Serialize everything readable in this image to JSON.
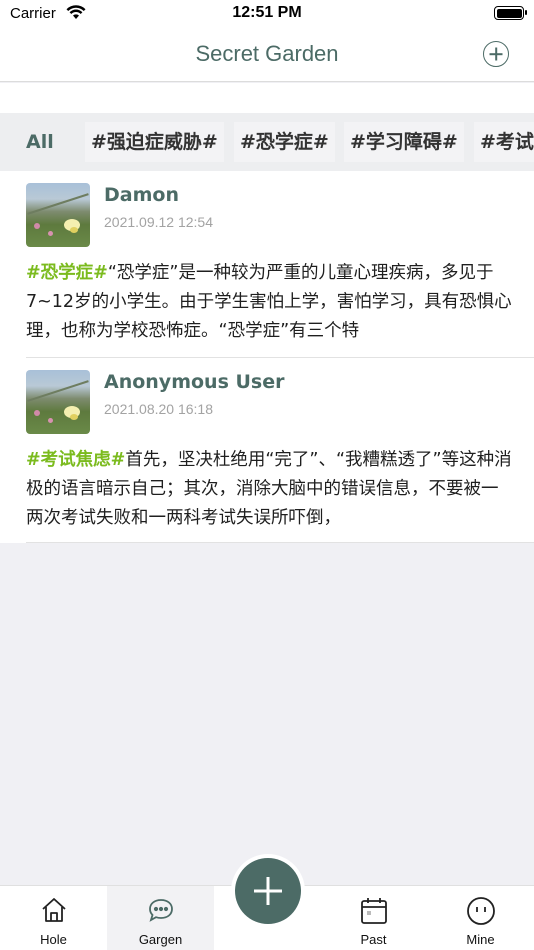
{
  "status_bar": {
    "carrier": "Carrier",
    "time": "12:51 PM"
  },
  "nav": {
    "title": "Secret Garden"
  },
  "tags": [
    "All",
    "#强迫症威胁#",
    "#恐学症#",
    "#学习障碍#",
    "#考试"
  ],
  "posts": [
    {
      "user": "Damon",
      "time": "2021.09.12 12:54",
      "hashtag": "#恐学症#",
      "text": "“恐学症”是一种较为严重的儿童心理疾病，多见于7~12岁的小学生。由于学生害怕上学，害怕学习，具有恐惧心理，也称为学校恐怖症。“恐学症”有三个特"
    },
    {
      "user": "Anonymous User",
      "time": "2021.08.20 16:18",
      "hashtag": "#考试焦虑#",
      "text": "首先，坚决杜绝用“完了”、“我糟糕透了”等这种消极的语言暗示自己；其次，消除大脑中的错误信息，不要被一两次考试失败和一两科考试失误所吓倒，"
    }
  ],
  "tab_bar": {
    "tabs": [
      {
        "label": "Hole",
        "icon": "home-icon"
      },
      {
        "label": "Gargen",
        "icon": "chat-bubble-icon"
      },
      {
        "label": "Past",
        "icon": "calendar-icon"
      },
      {
        "label": "Mine",
        "icon": "smiley-icon"
      }
    ]
  },
  "colors": {
    "brand": "#4c6b66",
    "hashtag": "#7bbb1e",
    "timestamp": "#a3a3a3"
  }
}
